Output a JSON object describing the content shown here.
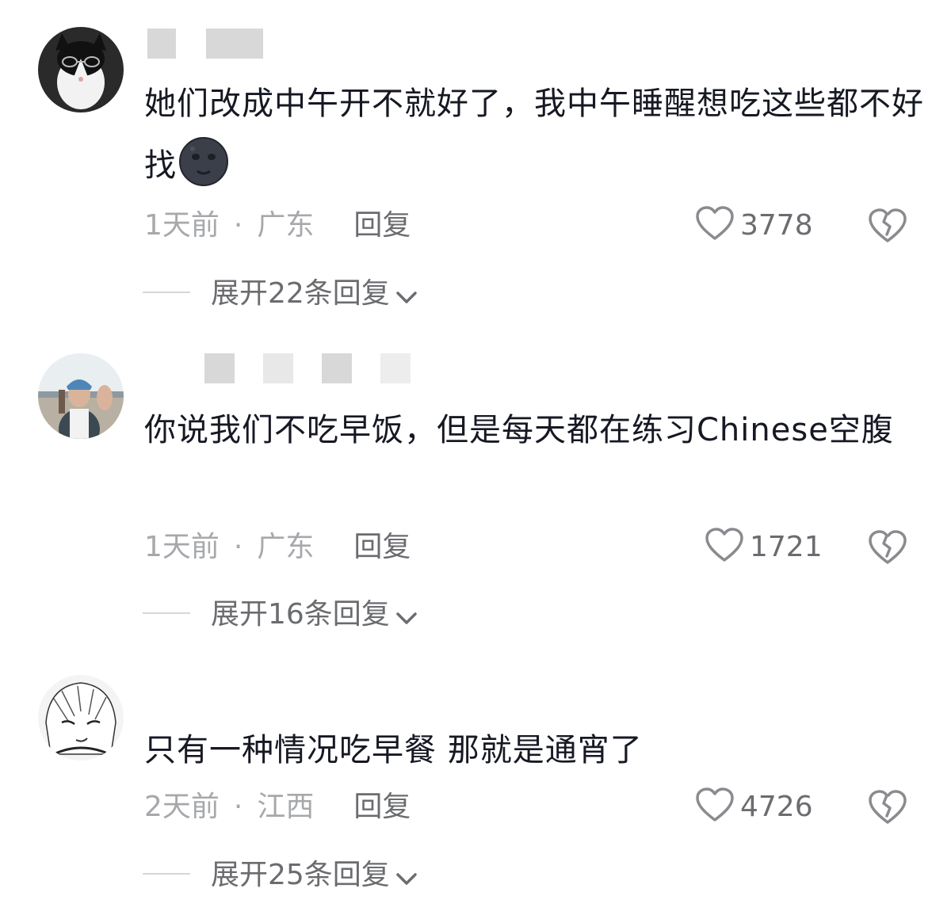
{
  "comments": [
    {
      "avatar_icon": "cat-avatar",
      "text": "她们改成中午开不就好了，我中午睡醒想吃这些都不好找",
      "emoji_icon": "new-moon-face-emoji",
      "time": "1天前",
      "location": "广东",
      "reply_label": "回复",
      "likes": "3778",
      "expand_label": "展开22条回复"
    },
    {
      "avatar_icon": "person-waving-avatar",
      "text": "你说我们不吃早饭，但是每天都在练习Chinese空腹",
      "time": "1天前",
      "location": "广东",
      "reply_label": "回复",
      "likes": "1721",
      "expand_label": "展开16条回复"
    },
    {
      "avatar_icon": "anime-sketch-avatar",
      "text": "只有一种情况吃早餐 那就是通宵了",
      "time": "2天前",
      "location": "江西",
      "reply_label": "回复",
      "likes": "4726",
      "expand_label": "展开25条回复"
    }
  ],
  "colors": {
    "text": "#161823",
    "meta": "#a7a8ab",
    "action": "#6b6c70"
  }
}
